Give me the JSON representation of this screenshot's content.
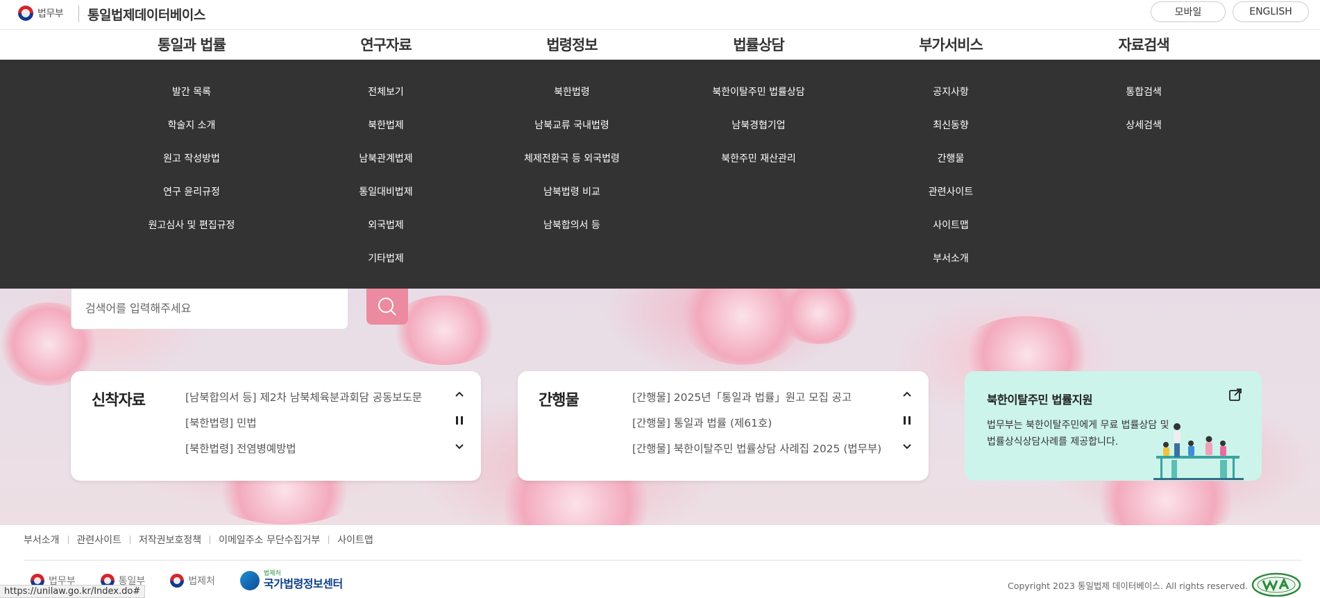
{
  "header": {
    "gov_label": "법무부",
    "site_title": "통일법제데이터베이스",
    "mobile_label": "모바일",
    "english_label": "ENGLISH"
  },
  "gnb": [
    {
      "label": "통일과 법률",
      "items": [
        "발간 목록",
        "학술지 소개",
        "원고 작성방법",
        "연구 윤리규정",
        "원고심사 및 편집규정"
      ]
    },
    {
      "label": "연구자료",
      "items": [
        "전체보기",
        "북한법제",
        "남북관계법제",
        "통일대비법제",
        "외국법제",
        "기타법제"
      ]
    },
    {
      "label": "법령정보",
      "items": [
        "북한법령",
        "남북교류 국내법령",
        "체제전환국 등 외국법령",
        "남북법령 비교",
        "남북합의서 등"
      ]
    },
    {
      "label": "법률상담",
      "items": [
        "북한이탈주민 법률상담",
        "남북경협기업",
        "북한주민 재산관리"
      ]
    },
    {
      "label": "부가서비스",
      "items": [
        "공지사항",
        "최신동향",
        "간행물",
        "관련사이트",
        "사이트맵",
        "부서소개"
      ]
    },
    {
      "label": "자료검색",
      "items": [
        "통합검색",
        "상세검색"
      ]
    }
  ],
  "search": {
    "placeholder": "검색어를 입력해주세요",
    "button_icon": "search-icon"
  },
  "new_materials": {
    "title": "신착자료",
    "items": [
      "[남북합의서 등] 제2차 남북체육분과회담 공동보도문",
      "[북한법령] 민법",
      "[북한법령] 전염병예방법"
    ]
  },
  "publications": {
    "title": "간행물",
    "items": [
      "[간행물] 2025년「통일과 법률」원고 모집 공고",
      "[간행물] 통일과 법률 (제61호)",
      "[간행물] 북한이탈주민 법률상담 사례집 2025 (법무부)"
    ]
  },
  "support": {
    "title": "북한이탈주민 법률지원",
    "desc": "법무부는 북한이탈주민에게 무료 법률상담 및 법률상식상담사례를 제공합니다.",
    "link_icon": "external-link-icon"
  },
  "footer": {
    "links": [
      "부서소개",
      "관련사이트",
      "저작권보호정책",
      "이메일주소 무단수집거부",
      "사이트맵"
    ],
    "logos": [
      "법무부",
      "통일부",
      "법제처"
    ],
    "law_center_small": "법제처",
    "law_center_name": "국가법령정보센터",
    "copyright": "Copyright 2023 통일법제 데이터베이스. All rights reserved.",
    "status_url": "https://unilaw.go.kr/Index.do#"
  },
  "colors": {
    "menu_bg": "#333333",
    "search_button": "#ec8aa0",
    "support_card": "#ccf4ea"
  }
}
